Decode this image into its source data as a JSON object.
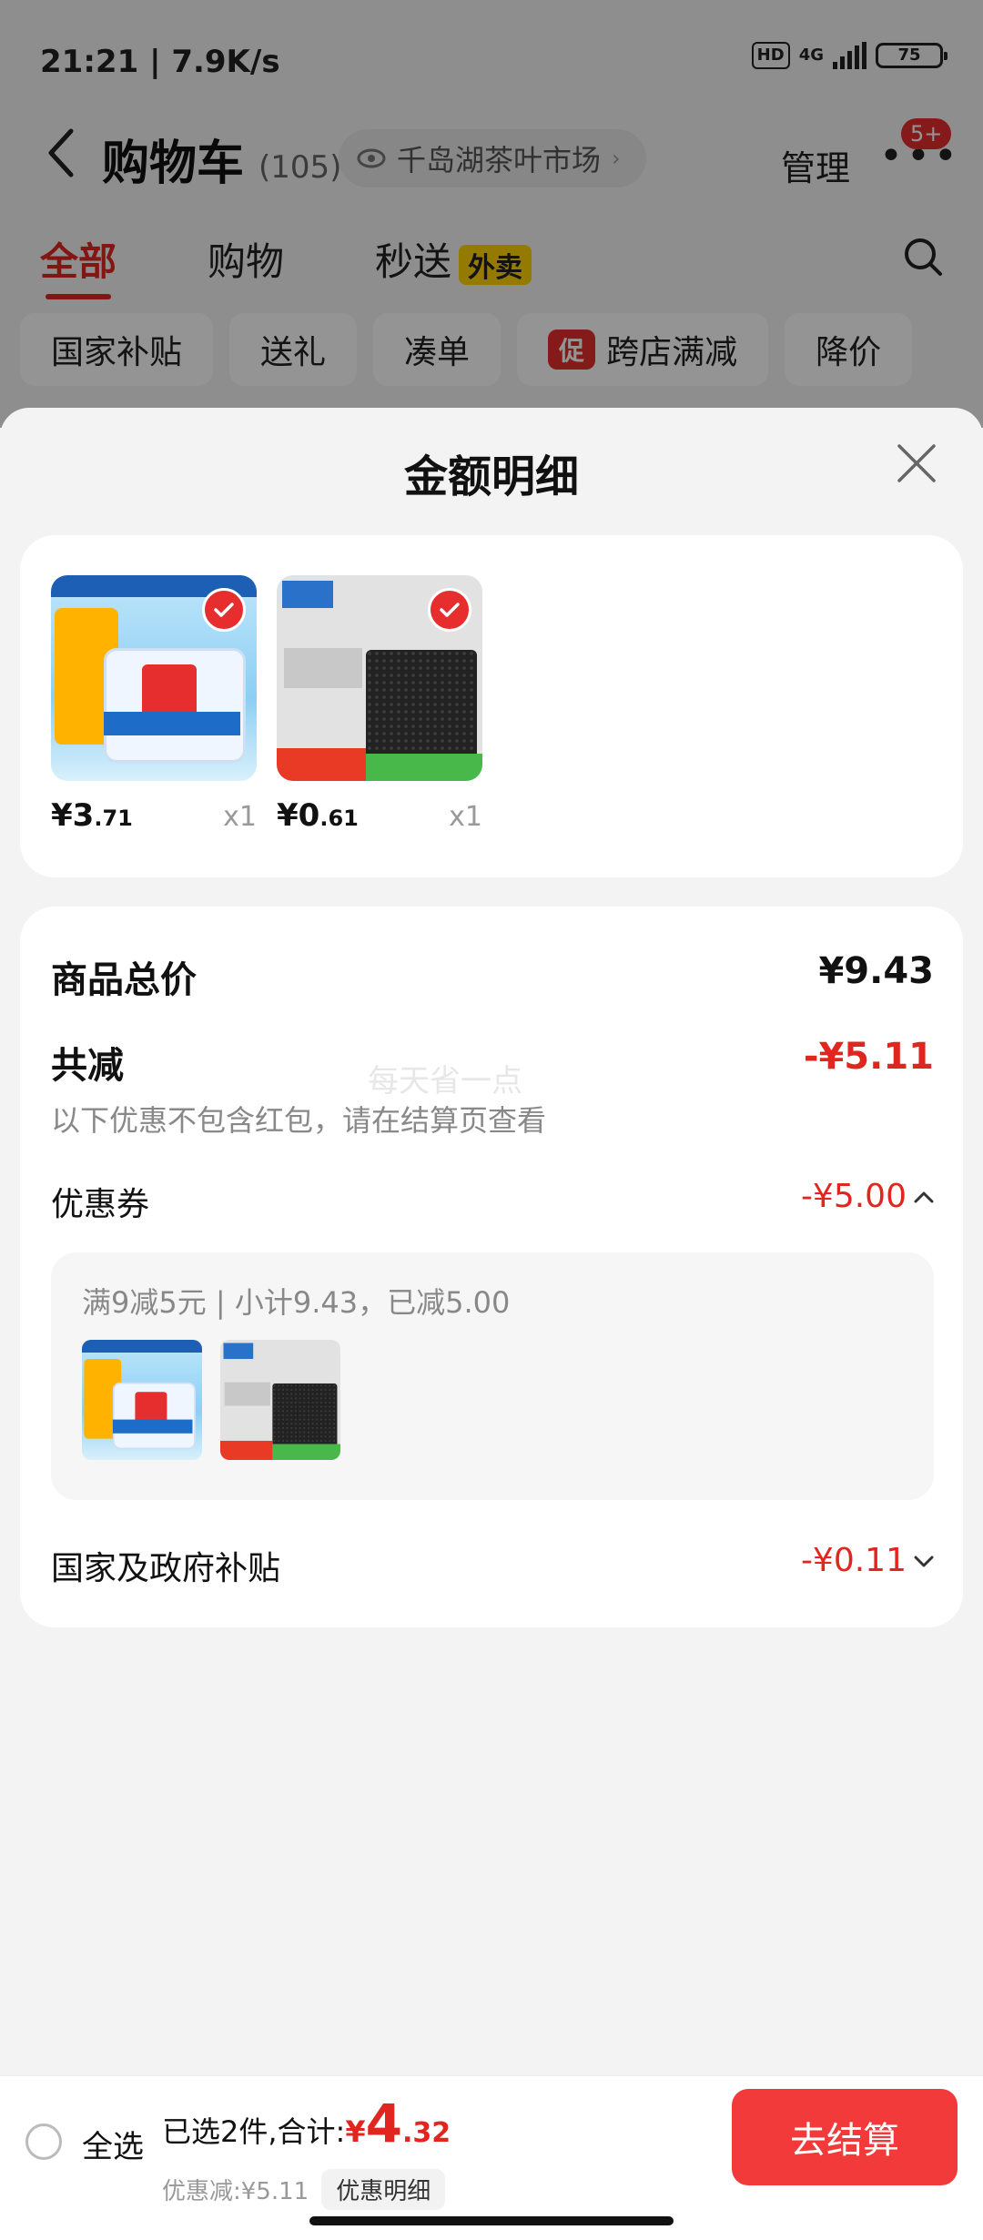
{
  "status_bar": {
    "time_speed": "21:21 | 7.9K/s",
    "hd": "HD",
    "net": "4G",
    "battery": "75"
  },
  "nav": {
    "title": "购物车",
    "count": "(105)",
    "location": "千岛湖茶叶市场",
    "manage": "管理",
    "badge": "5+"
  },
  "tabs": [
    {
      "label": "全部"
    },
    {
      "label": "购物"
    },
    {
      "label": "秒送",
      "tag": "外卖"
    }
  ],
  "chips": [
    {
      "label": "国家补贴"
    },
    {
      "label": "送礼"
    },
    {
      "label": "凑单"
    },
    {
      "label": "跨店满减",
      "tag": "促"
    },
    {
      "label": "降价"
    }
  ],
  "sheet": {
    "title": "金额明细",
    "products": [
      {
        "price_int": "¥3",
        "price_dec": ".71",
        "qty": "x1"
      },
      {
        "price_int": "¥0",
        "price_dec": ".61",
        "qty": "x1"
      }
    ],
    "total_label": "商品总价",
    "total_value": "¥9.43",
    "reduce_label": "共减",
    "reduce_value": "-¥5.11",
    "watermark": "每天省一点",
    "note": "以下优惠不包含红包，请在结算页查看",
    "coupon_label": "优惠券",
    "coupon_value": "-¥5.00",
    "coupon_desc": "满9减5元 | 小计9.43，已减5.00",
    "subsidy_label": "国家及政府补贴",
    "subsidy_value": "-¥0.11"
  },
  "bottom": {
    "select_all": "全选",
    "summary_prefix": "已选2件,合计:",
    "total_symbol": "¥",
    "total_int": "4",
    "total_dec": ".32",
    "discount_text": "优惠减:¥5.11",
    "detail_button": "优惠明细",
    "checkout": "去结算"
  },
  "colors": {
    "accent": "#e0261f",
    "checkout_bg": "#f23a3a",
    "takeout_tag": "#ffd400"
  }
}
